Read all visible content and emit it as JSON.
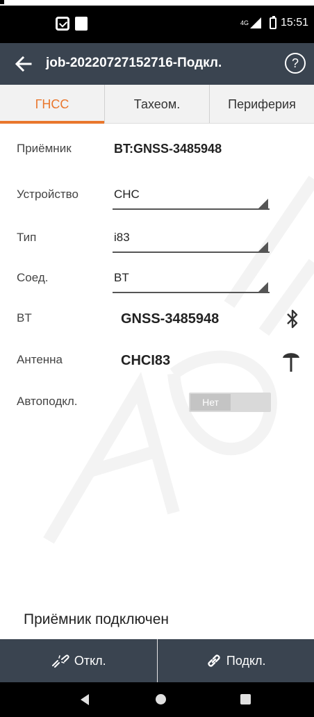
{
  "status_bar": {
    "network": "4G",
    "time": "15:51"
  },
  "app_bar": {
    "title": "job-20220727152716-Подкл.",
    "help_symbol": "?"
  },
  "tabs": [
    {
      "label": "ГНСС",
      "active": true
    },
    {
      "label": "Тахеом.",
      "active": false
    },
    {
      "label": "Периферия",
      "active": false
    }
  ],
  "fields": {
    "receiver": {
      "label": "Приёмник",
      "value": "BT:GNSS-3485948"
    },
    "device": {
      "label": "Устройство",
      "value": "CHC"
    },
    "type": {
      "label": "Тип",
      "value": "i83"
    },
    "connection": {
      "label": "Соед.",
      "value": "BT"
    },
    "bt": {
      "label": "BT",
      "value": "GNSS-3485948"
    },
    "antenna": {
      "label": "Антенна",
      "value": "CHCI83"
    },
    "autoconnect": {
      "label": "Автоподкл.",
      "value": "Нет"
    }
  },
  "status_message": "Приёмник подключен",
  "buttons": {
    "disconnect": "Откл.",
    "connect": "Подкл."
  },
  "colors": {
    "accent": "#e9772d",
    "appbar": "#3a4450"
  }
}
